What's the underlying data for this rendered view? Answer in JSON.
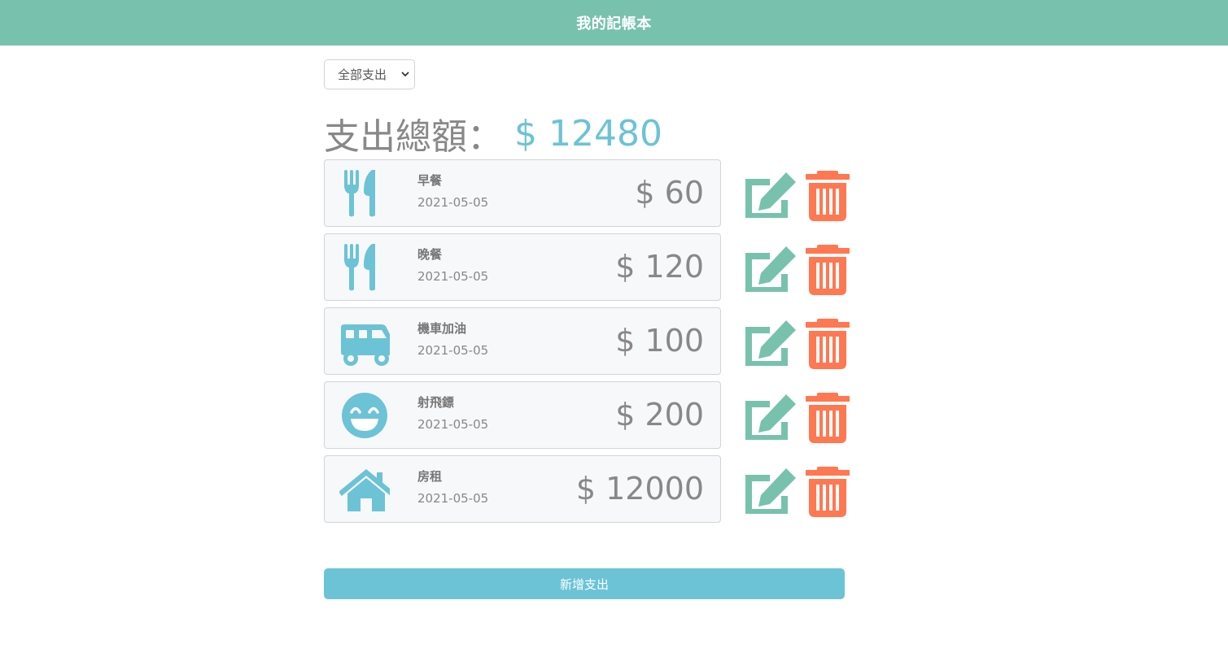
{
  "header": {
    "title": "我的記帳本"
  },
  "filter": {
    "selected": "全部支出"
  },
  "summary": {
    "label": "支出總額：",
    "total": "$ 12480"
  },
  "expenses": [
    {
      "icon": "utensils-icon",
      "name": "早餐",
      "date": "2021-05-05",
      "amount": "$ 60"
    },
    {
      "icon": "utensils-icon",
      "name": "晚餐",
      "date": "2021-05-05",
      "amount": "$ 120"
    },
    {
      "icon": "shuttle-van-icon",
      "name": "機車加油",
      "date": "2021-05-05",
      "amount": "$ 100"
    },
    {
      "icon": "grin-beam-icon",
      "name": "射飛鏢",
      "date": "2021-05-05",
      "amount": "$ 200"
    },
    {
      "icon": "home-icon",
      "name": "房租",
      "date": "2021-05-05",
      "amount": "$ 12000"
    }
  ],
  "actions": {
    "add_label": "新增支出"
  },
  "colors": {
    "navbar": "#78c2ad",
    "accent": "#6cc3d5",
    "edit": "#78c2ad",
    "delete": "#ff7851"
  }
}
